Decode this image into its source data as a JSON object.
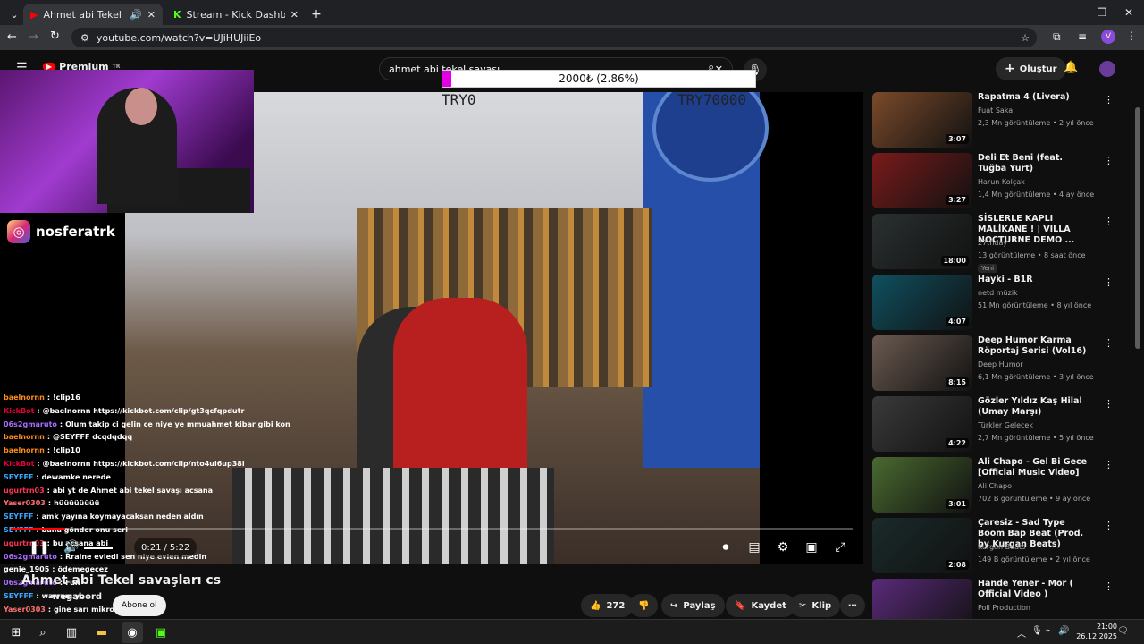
{
  "browser": {
    "tabs": [
      {
        "title": "Ahmet abi Tekel savaşları cs",
        "active": true
      },
      {
        "title": "Stream - Kick Dashboard",
        "active": false
      }
    ],
    "url": "youtube.com/watch?v=UJiHUJiiEo",
    "profile_initial": "V"
  },
  "youtube": {
    "logo": "Premium",
    "logo_sup": "TR",
    "search_value": "ahmet abi tekel savaşı",
    "create_label": "Oluştur",
    "video": {
      "title": "Ahmet abi Tekel savaşları cs",
      "time_current": "0:21",
      "time_total": "5:22",
      "progress": 0.065,
      "subscribe_label": "Abone ol",
      "likes": "272",
      "share_label": "Paylaş",
      "save_label": "Kaydet",
      "clip_label": "Klip"
    },
    "overlay": {
      "donation_text": "2000₺ (2.86%)",
      "donation_fraction": 0.0286,
      "try_left": "TRY0",
      "try_right": "TRY70000",
      "instagram_handle": "nosferatrk",
      "channel_partial": "wegabord"
    },
    "chat": [
      {
        "user": "baelnornn",
        "text": "!clip16",
        "ucolor": "#ff8c1a"
      },
      {
        "user": "KickBot",
        "text": "@baelnornn https://kickbot.com/clip/gt3qcfqpdutr",
        "ucolor": "#e4003a"
      },
      {
        "user": "06s2gmaruto",
        "text": "Olum takip ci gelin ce niye ye mmuahmet kibar gibi konuşuyon",
        "ucolor": "#a86cff"
      },
      {
        "user": "baelnornn",
        "text": "@SEYFFF dcqdqdqq",
        "ucolor": "#ff8c1a"
      },
      {
        "user": "baelnornn",
        "text": "!clip10",
        "ucolor": "#ff8c1a"
      },
      {
        "user": "KickBot",
        "text": "@baelnornn https://kickbot.com/clip/nto4ui6up38i",
        "ucolor": "#e4003a"
      },
      {
        "user": "SEYFFF",
        "text": "dewamke nerede",
        "ucolor": "#3ea6ff"
      },
      {
        "user": "ugurtrn03",
        "text": "abi yt de Ahmet abi tekel savaşı acsana",
        "ucolor": "#ff3355"
      },
      {
        "user": "Yaser0303",
        "text": "hüüüüüüüü",
        "ucolor": "#ff7070"
      },
      {
        "user": "SEYFFF",
        "text": "amk yayına koymayacaksan neden aldın",
        "ucolor": "#3ea6ff"
      },
      {
        "user": "SEYFFF",
        "text": "bana gönder onu seri",
        "ucolor": "#3ea6ff"
      },
      {
        "user": "ugurtrn03",
        "text": "bu acsana abi",
        "ucolor": "#ff3355"
      },
      {
        "user": "06s2gmaruto",
        "text": "Rraine evledi sen niye evlen medin",
        "ucolor": "#a86cff"
      },
      {
        "user": "genie_1905",
        "text": "ödemegecez",
        "ucolor": "#ffffff"
      },
      {
        "user": "06s2gmaruto",
        "text": "Fun",
        "ucolor": "#a86cff"
      },
      {
        "user": "SEYFFF",
        "text": "warram yo",
        "ucolor": "#3ea6ff"
      },
      {
        "user": "Yaser0303",
        "text": "gine sarı mikrofonmu",
        "ucolor": "#ff7070"
      }
    ],
    "recommendations": [
      {
        "title": "Rapatma 4 (Livera)",
        "channel": "Fuat Saka",
        "stats": "2,3 Mn görüntüleme • 2 yıl önce",
        "duration": "3:07",
        "thumb": "#7a4a2a",
        "badge": ""
      },
      {
        "title": "Deli Et Beni (feat. Tuğba Yurt)",
        "channel": "Harun Kolçak",
        "stats": "1,4 Mn görüntüleme • 4 ay önce",
        "duration": "3:27",
        "thumb": "#7a1a1a",
        "badge": ""
      },
      {
        "title": "SİSLERLE KAPLI MALİKANE ! | VILLA NOCTURNE DEMO ...",
        "channel": "27thday",
        "stats": "13 görüntüleme • 8 saat önce",
        "duration": "18:00",
        "thumb": "#2a3030",
        "badge": "Yeni"
      },
      {
        "title": "Hayki - B1R",
        "channel": "netd müzik",
        "stats": "51 Mn görüntüleme • 8 yıl önce",
        "duration": "4:07",
        "thumb": "#0f5060",
        "badge": ""
      },
      {
        "title": "Deep Humor Karma Röportaj Serisi (Vol16)",
        "channel": "Deep Humor",
        "stats": "6,1 Mn görüntüleme • 3 yıl önce",
        "duration": "8:15",
        "thumb": "#6a5a50",
        "badge": ""
      },
      {
        "title": "Gözler Yıldız Kaş Hilal (Umay Marşı)",
        "channel": "Türkler Gelecek",
        "stats": "2,7 Mn görüntüleme • 5 yıl önce",
        "duration": "4:22",
        "thumb": "#3a3a3a",
        "badge": ""
      },
      {
        "title": "Ali Chapo - Gel Bi Gece [Official Music Video]",
        "channel": "Ali Chapo",
        "stats": "702 B görüntüleme • 9 ay önce",
        "duration": "3:01",
        "thumb": "#4a6a30",
        "badge": ""
      },
      {
        "title": "Çaresiz - Sad Type Boom Bap Beat (Prod. by Kurgan Beats)",
        "channel": "Kurgan Beats",
        "stats": "149 B görüntüleme • 2 yıl önce",
        "duration": "2:08",
        "thumb": "#1a2a2a",
        "badge": ""
      },
      {
        "title": "Hande Yener - Mor ( Official Video )",
        "channel": "Poll Production",
        "stats": "",
        "duration": "",
        "thumb": "#5a2a7a",
        "badge": ""
      }
    ]
  },
  "taskbar": {
    "time": "21:00",
    "date": "26.12.2025"
  }
}
